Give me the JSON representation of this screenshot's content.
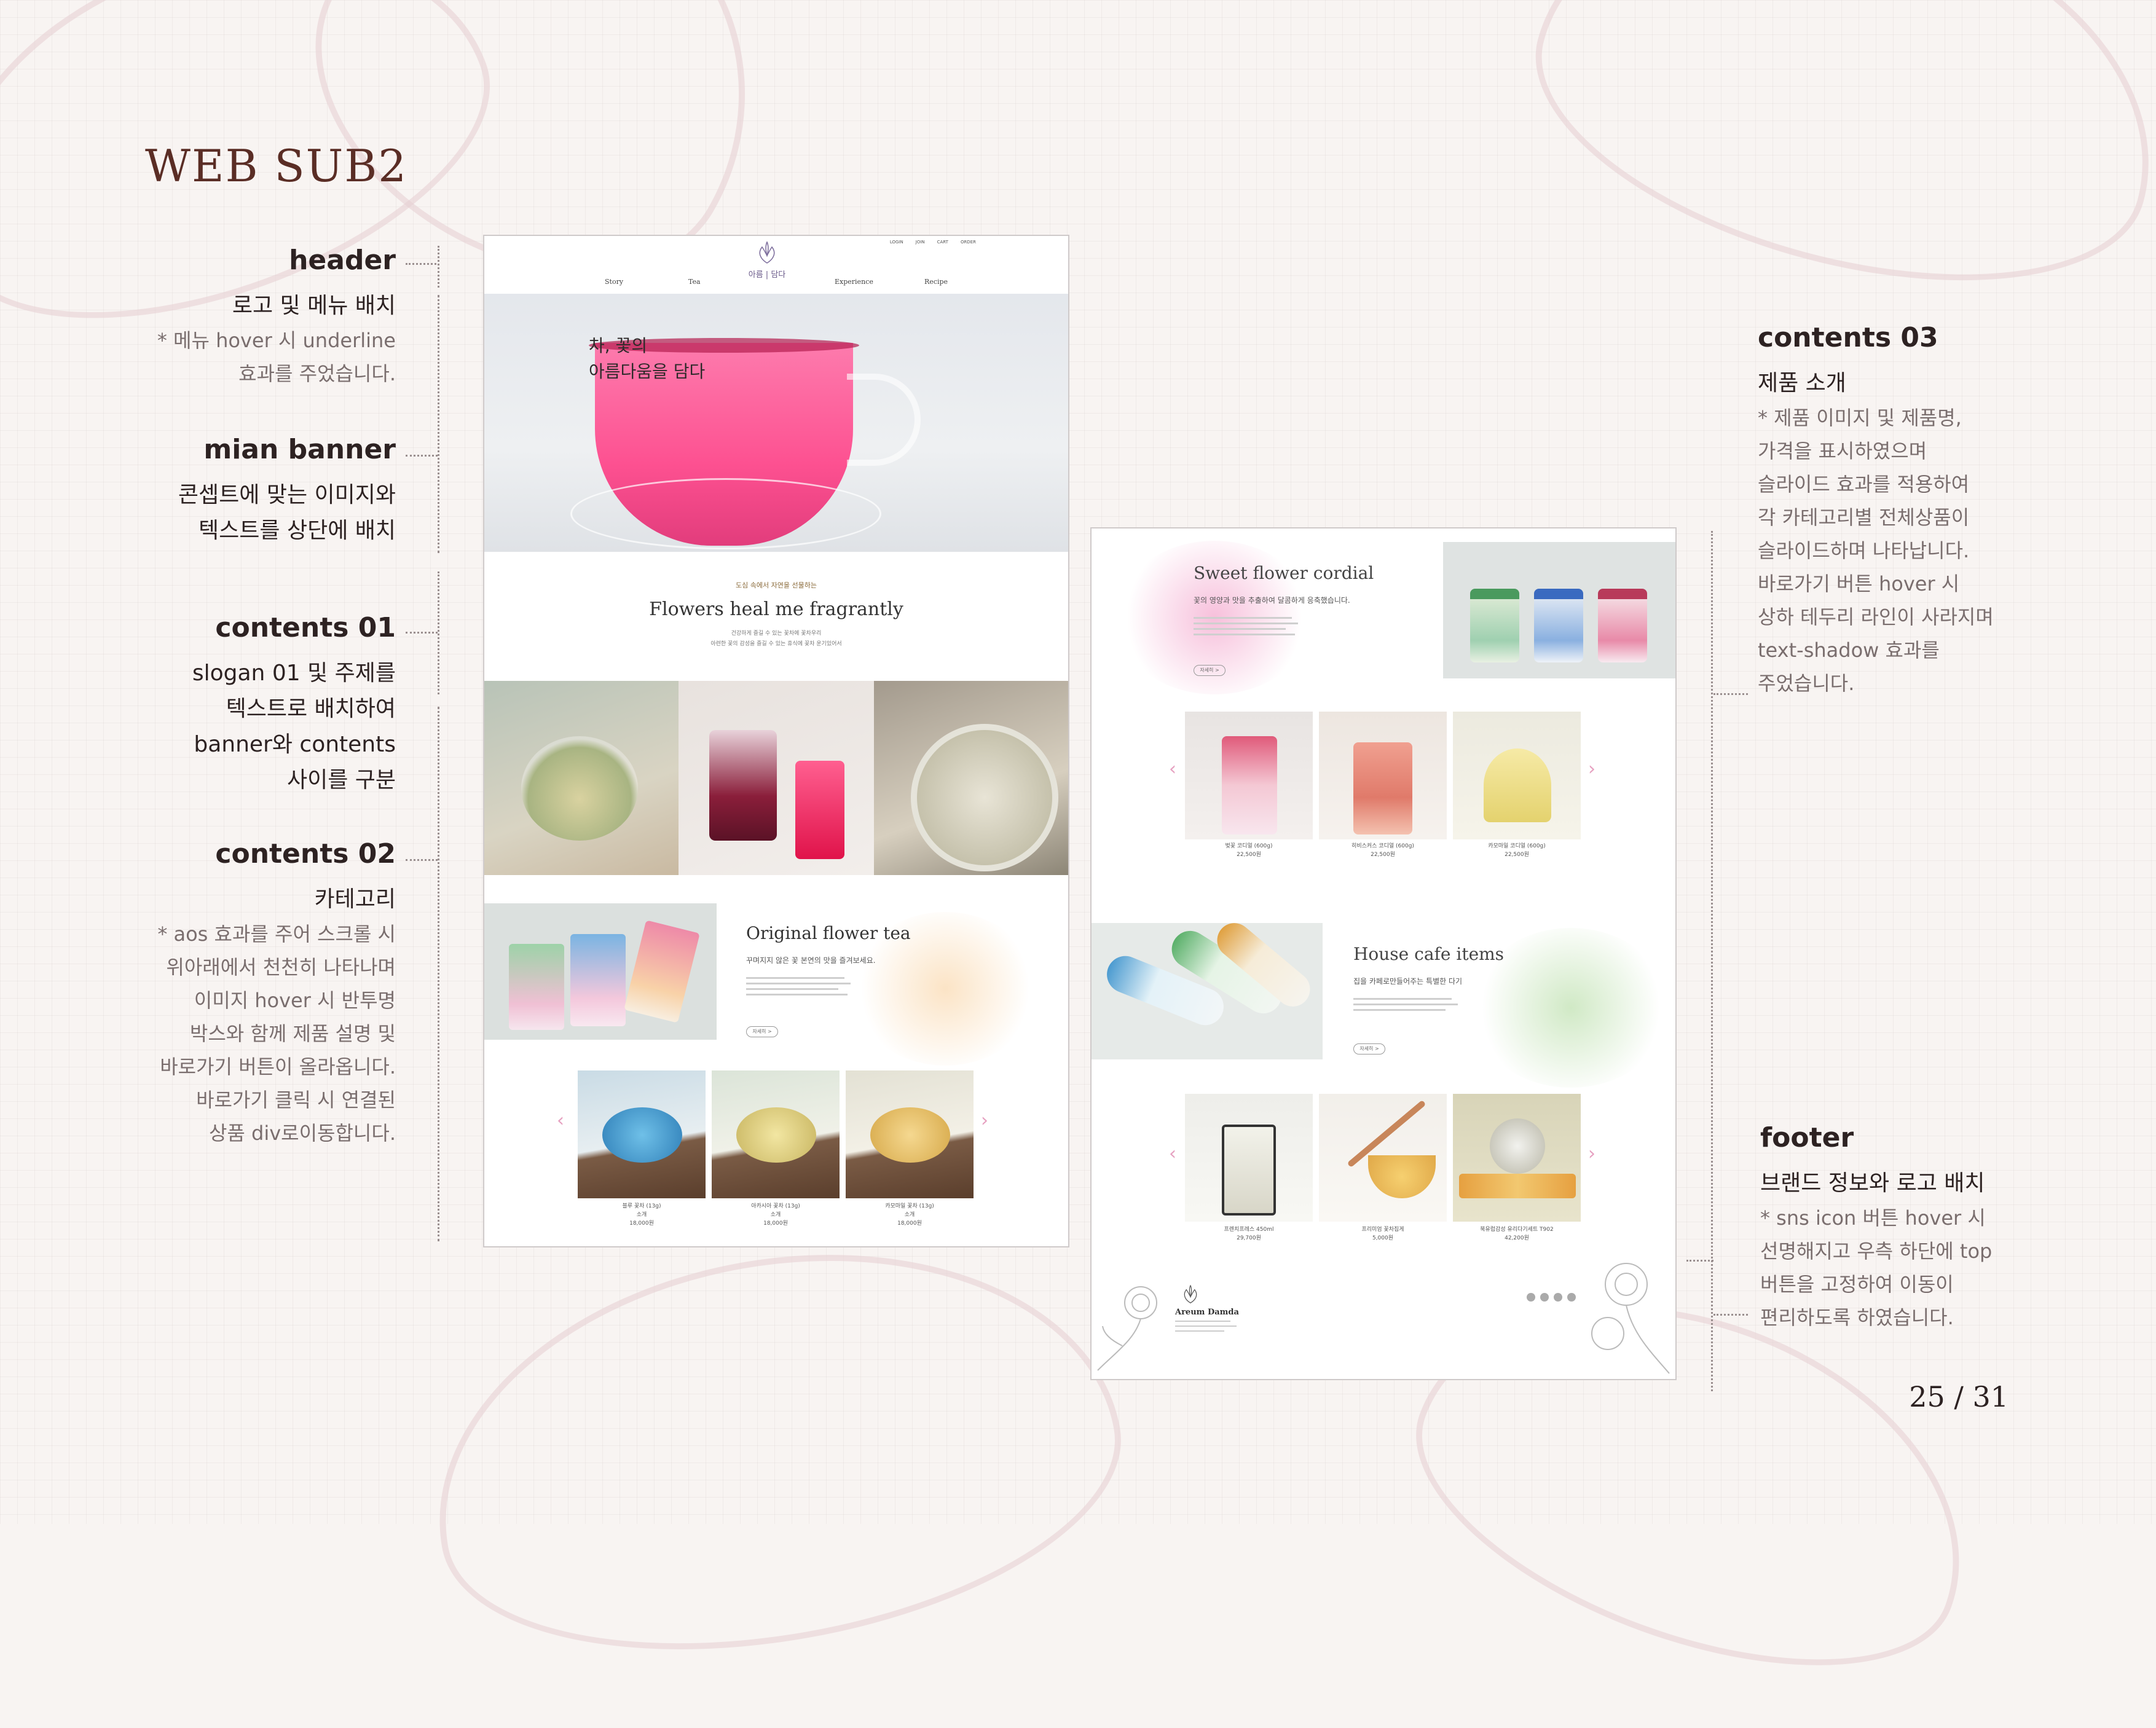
{
  "page": {
    "title": "WEB SUB2",
    "page_number": "25 / 31"
  },
  "left_notes": {
    "header": {
      "heading": "header",
      "desc": "로고 및 메뉴 배치",
      "note1": "* 메뉴 hover 시 underline",
      "note2": "효과를 주었습니다."
    },
    "banner": {
      "heading": "mian banner",
      "desc1": "콘셉트에 맞는 이미지와",
      "desc2": "텍스트를 상단에 배치"
    },
    "c01": {
      "heading": "contents 01",
      "l1": "slogan 01 및 주제를",
      "l2": "텍스트로 배치하여",
      "l3": "banner와 contents",
      "l4": "사이를 구분"
    },
    "c02": {
      "heading": "contents 02",
      "desc": "카테고리",
      "n1": "* aos 효과를 주어 스크롤 시",
      "n2": "위아래에서 천천히 나타나며",
      "n3": "이미지 hover 시 반투명",
      "n4": "박스와 함께 제품 설명 및",
      "n5": "바로가기 버튼이 올라옵니다.",
      "n6": "바로가기 클릭 시 연결된",
      "n7": "상품 div로이동합니다."
    }
  },
  "right_notes": {
    "c03": {
      "heading": "contents 03",
      "desc": "제품 소개",
      "n1": "* 제품 이미지 및 제품명,",
      "n2": "가격을 표시하였으며",
      "n3": "슬라이드 효과를 적용하여",
      "n4": "각 카테고리별 전체상품이",
      "n5": "슬라이드하며 나타납니다.",
      "n6": "바로가기 버튼 hover 시",
      "n7": "상하 테두리 라인이 사라지며",
      "n8": "text-shadow 효과를",
      "n9": "주었습니다."
    },
    "footer": {
      "heading": "footer",
      "desc": "브랜드 정보와 로고 배치",
      "n1": "* sns icon 버튼 hover 시",
      "n2": "선명해지고 우측 하단에 top",
      "n3": "버튼을 고정하여 이동이",
      "n4": "편리하도록 하였습니다."
    }
  },
  "shot1": {
    "topnav": [
      "LOGIN",
      "JOIN",
      "CART",
      "ORDER"
    ],
    "menu_left": [
      "Story",
      "Tea"
    ],
    "logo": "아름 | 담다",
    "menu_right": [
      "Experience",
      "Recipe"
    ],
    "hero_line1": "차, 꽃의",
    "hero_line2": "아름다움을 담다",
    "slogan_small": "도심 속에서 자연을 선물하는",
    "slogan_title": "Flowers heal me fragrantly",
    "slogan_sub1": "건강하게 즐길 수 있는 꽃차에 꽃차우리",
    "slogan_sub2": "아련한 꽃의 감성을 즐길 수 있는 휴식에 꽃차 운기있어서",
    "section_title": "Original flower tea",
    "section_desc": "꾸며지지 않은 꽃 본연의 맛을 즐겨보세요.",
    "more_btn": "자세히 >",
    "products": [
      {
        "name": "블루 꽃차 (13g)",
        "desc": "소개",
        "price": "18,000원"
      },
      {
        "name": "아카시아 꽃차 (13g)",
        "desc": "소개",
        "price": "18,000원"
      },
      {
        "name": "카모마일 꽃차 (13g)",
        "desc": "소개",
        "price": "18,000원"
      }
    ]
  },
  "shot2": {
    "cordial_title": "Sweet flower cordial",
    "cordial_desc": "꽃의 영양과 맛을 추출하여 달콤하게 응축했습니다.",
    "more_btn": "자세히 >",
    "cordials": [
      {
        "name": "벚꽃 코디얼 (600g)",
        "price": "22,500원"
      },
      {
        "name": "히비스커스 코디얼 (600g)",
        "price": "22,500원"
      },
      {
        "name": "카모마일 코디얼 (600g)",
        "price": "22,500원"
      }
    ],
    "cafe_title": "House cafe items",
    "cafe_desc": "집을 카페로만들어주는 특별한 다기",
    "cafe_items": [
      {
        "name": "프렌치프레스 450ml",
        "price": "29,700원"
      },
      {
        "name": "프리미엄 꽃차집게",
        "price": "5,000원"
      },
      {
        "name": "북유럽감성 유리다기세트 T902",
        "price": "42,200원"
      }
    ],
    "footer_brand": "Areum Damda"
  }
}
